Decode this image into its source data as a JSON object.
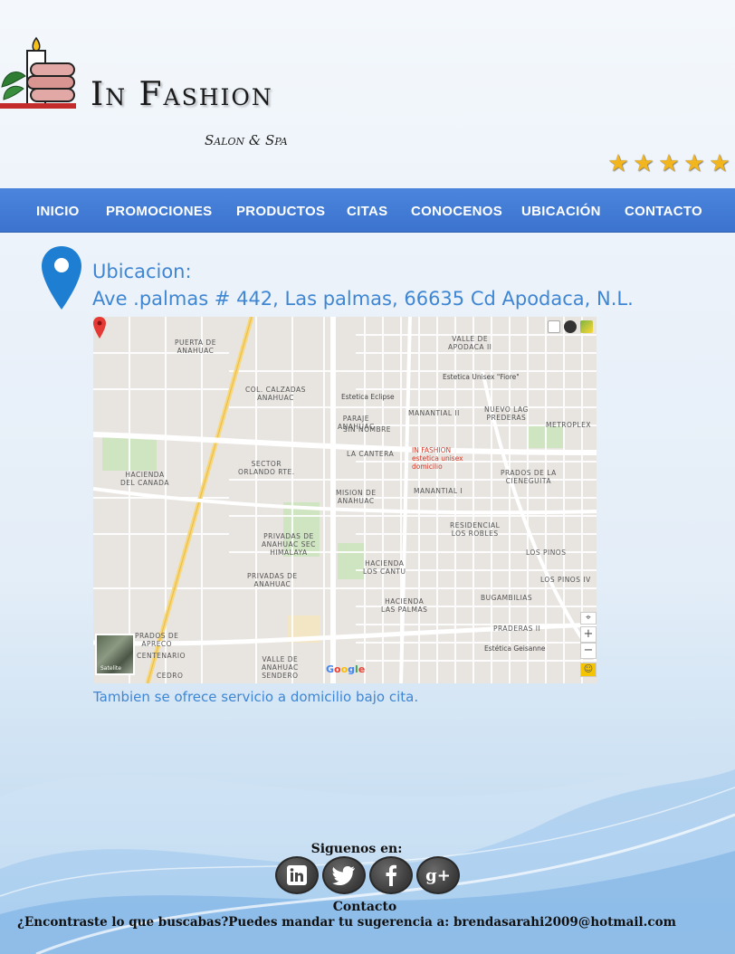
{
  "header": {
    "logo_title": "In Fashion",
    "logo_subtitle": "Salon & Spa",
    "rating_stars": 5
  },
  "nav": {
    "items": [
      {
        "label": "INICIO"
      },
      {
        "label": "PROMOCIONES"
      },
      {
        "label": "PRODUCTOS"
      },
      {
        "label": "CITAS"
      },
      {
        "label": "CONOCENOS"
      },
      {
        "label": "UBICACIÓN"
      },
      {
        "label": "CONTACTO"
      }
    ]
  },
  "location": {
    "label": "Ubicacion:",
    "address": "Ave .palmas # 442, Las palmas, 66635 Cd Apodaca, N.L.",
    "service_note": "Tambien se ofrece servicio a domicilio bajo cita."
  },
  "map": {
    "marker_label": "IN FASHION",
    "marker_sub": [
      "estetica unisex",
      "domicilio"
    ],
    "google_logo": "Google",
    "satellite_label": "Satelite",
    "zoom_in": "+",
    "zoom_out": "−",
    "labels": [
      "PUERTA DE\nANAHUAC",
      "COL. CALZADAS\nANAHUAC",
      "PARAJE\nANAHUAC",
      "SIN NOMBRE",
      "LA CANTERA",
      "SECTOR\nORLANDO RTE.",
      "HACIENDA\nDEL CANADA",
      "MISION DE\nANAHUAC",
      "PRIVADAS DE\nANAHUAC SEC\nHIMALAYA",
      "PRIVADAS DE\nANAHUAC",
      "HACIENDA\nLOS CANTU",
      "HACIENDA\nLAS PALMAS",
      "RESIDENCIAL\nLOS ROBLES",
      "VALLE DE\nAPODACA II",
      "MANANTIAL II",
      "NUEVO LAG\nPREDERAS",
      "METROPLEX",
      "MANANTIAL I",
      "PRADOS DE LA\nCIENEGUITA",
      "LOS PINOS",
      "LOS PINOS IV",
      "BUGAMBILIAS",
      "PRADERAS II",
      "VALLE DE\nANAHUAC\nSENDERO",
      "CENTENARIO",
      "CEDRO",
      "PRADOS DE\nAPRECO",
      "METROPLEX"
    ],
    "poi": [
      "Estetica Unisex \"Fiore\"",
      "Estetica Eclipse",
      "Estética Geisanne"
    ]
  },
  "footer": {
    "follow_label": "Siguenos en:",
    "socials": [
      {
        "name": "linkedin",
        "glyph": "in"
      },
      {
        "name": "twitter",
        "glyph": "🐦"
      },
      {
        "name": "facebook",
        "glyph": "f"
      },
      {
        "name": "google-plus",
        "glyph": "g+"
      }
    ],
    "contact_label": "Contacto",
    "suggest_text": "¿Encontraste lo que buscabas?Puedes mandar tu sugerencia a: brendasarahi2009@hotmail.com"
  },
  "colors": {
    "nav_bg": "#3f78d6",
    "accent_text": "#3f86d3",
    "pin": "#1e7fd2",
    "stars": "#f2b51d"
  }
}
